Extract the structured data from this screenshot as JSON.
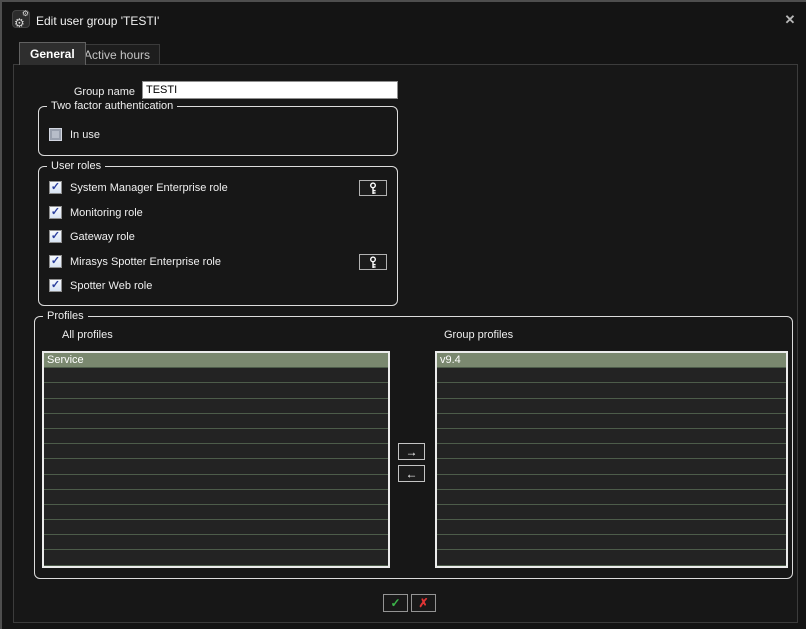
{
  "window": {
    "title": "Edit user group 'TESTI'",
    "close_icon": "✕"
  },
  "tabs": [
    {
      "label": "General",
      "active": true
    },
    {
      "label": "Active hours",
      "active": false
    }
  ],
  "form": {
    "group_name_label": "Group name",
    "group_name_value": "TESTI"
  },
  "two_factor": {
    "legend": "Two factor authentication",
    "checkbox_label": "In use",
    "checked": false
  },
  "user_roles": {
    "legend": "User roles",
    "roles": [
      {
        "label": "System Manager Enterprise role",
        "checked": true,
        "has_key_button": true
      },
      {
        "label": "Monitoring role",
        "checked": true,
        "has_key_button": false
      },
      {
        "label": "Gateway role",
        "checked": true,
        "has_key_button": false
      },
      {
        "label": "Mirasys Spotter Enterprise role",
        "checked": true,
        "has_key_button": true
      },
      {
        "label": "Spotter Web role",
        "checked": true,
        "has_key_button": false
      }
    ]
  },
  "profiles": {
    "legend": "Profiles",
    "all_profiles_label": "All profiles",
    "group_profiles_label": "Group profiles",
    "all_profiles": [
      "Service"
    ],
    "group_profiles": [
      "v9.4"
    ],
    "selected_all_profile": "Service",
    "selected_group_profile": "v9.4",
    "empty_rows_per_list": 13,
    "move_right_icon": "→",
    "move_left_icon": "←"
  },
  "footer": {
    "ok_icon": "✓",
    "cancel_icon": "✗"
  },
  "glyphs": {
    "check": "✓",
    "gear_big": "⚙",
    "gear_small": "⚙"
  },
  "colors": {
    "selected_row_green": "#7a886f",
    "ok_green": "#3cb54a",
    "cancel_red": "#e03535",
    "checkbox_check_blue": "#2b3f9e"
  }
}
